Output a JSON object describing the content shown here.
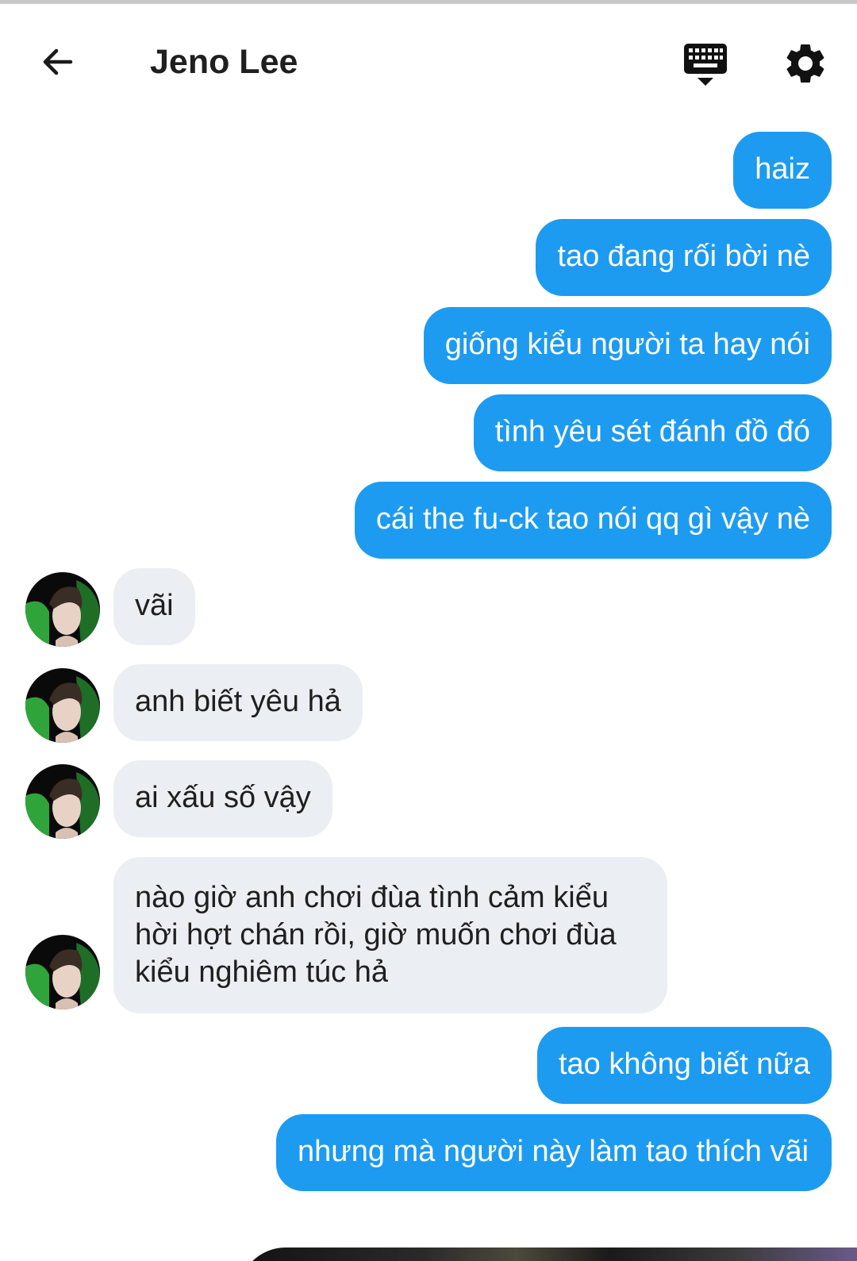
{
  "header": {
    "title": "Jeno Lee",
    "icons": [
      "back-arrow-icon",
      "keyboard-icon",
      "gear-icon"
    ]
  },
  "colors": {
    "outgoing_bubble": "#1d9bf0",
    "incoming_bubble": "#ebeef2",
    "text_dark": "#1f1f1f"
  },
  "messages": [
    {
      "from": "me",
      "text": "haiz"
    },
    {
      "from": "me",
      "text": "tao đang rối bời nè"
    },
    {
      "from": "me",
      "text": "giống kiểu người ta hay nói"
    },
    {
      "from": "me",
      "text": "tình yêu sét đánh đồ đó"
    },
    {
      "from": "me",
      "text": "cái the fu-ck tao nói qq gì vậy nè"
    },
    {
      "from": "them",
      "text": "vãi"
    },
    {
      "from": "them",
      "text": "anh biết yêu hả"
    },
    {
      "from": "them",
      "text": "ai xấu số vậy"
    },
    {
      "from": "them",
      "text": "nào giờ anh chơi đùa tình cảm kiểu hời hợt chán rồi, giờ muốn chơi đùa kiểu nghiêm túc hả"
    },
    {
      "from": "me",
      "text": "tao không biết nữa"
    },
    {
      "from": "me",
      "text": "nhưng mà người này làm tao thích vãi"
    }
  ]
}
